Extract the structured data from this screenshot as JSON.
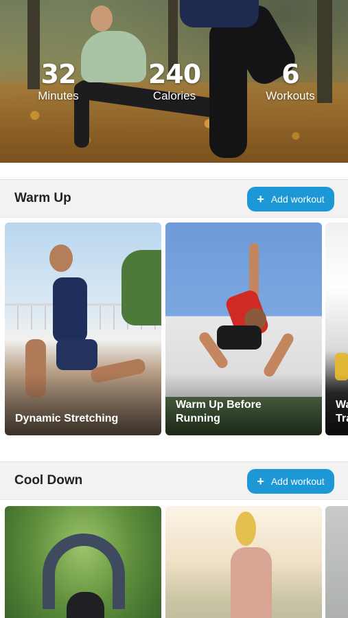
{
  "hero": {
    "stats": [
      {
        "value": "32",
        "label": "Minutes"
      },
      {
        "value": "240",
        "label": "Calories"
      },
      {
        "value": "6",
        "label": "Workouts"
      }
    ]
  },
  "sections": [
    {
      "title": "Warm Up",
      "add_label": "Add workout",
      "cards": [
        {
          "title": "Dynamic Stretching"
        },
        {
          "title": "Warm Up Before Running"
        },
        {
          "title": "Wa Tra"
        }
      ]
    },
    {
      "title": "Cool Down",
      "add_label": "Add workout",
      "cards": [
        {
          "title": ""
        },
        {
          "title": ""
        },
        {
          "title": ""
        }
      ]
    }
  ],
  "colors": {
    "accent": "#1d98d6",
    "section_bg": "#f2f2f2"
  },
  "icons": {
    "add": "plus-icon"
  }
}
